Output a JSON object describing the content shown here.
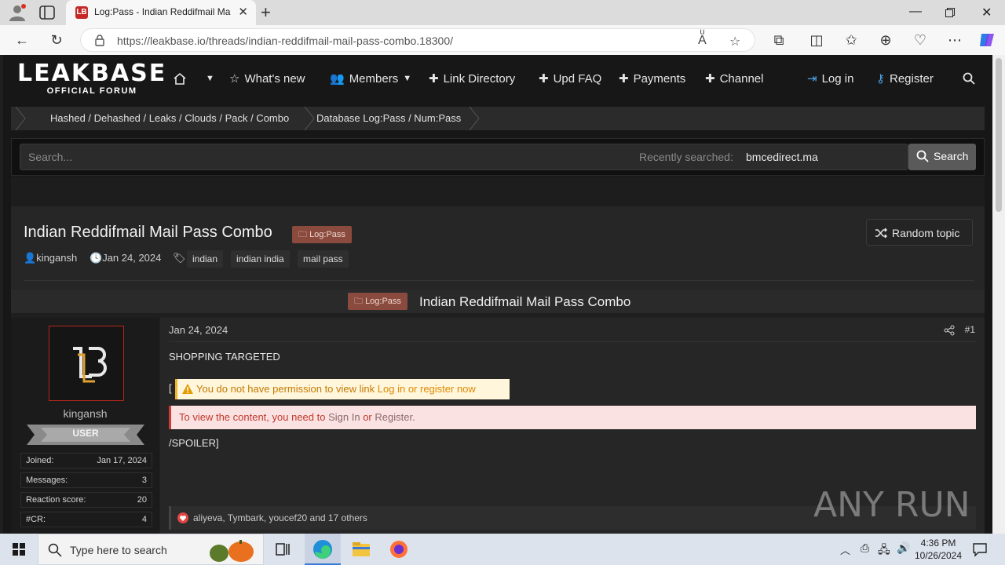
{
  "browser": {
    "tab_title": "Log:Pass - Indian Reddifmail Ma",
    "url": "https://leakbase.io/threads/indian-reddifmail-mail-pass-combo.18300/"
  },
  "site": {
    "logo_main": "LEAKBASE",
    "logo_sub": "OFFICIAL FORUM",
    "nav": {
      "whats_new": "What's new",
      "members": "Members",
      "link_directory": "Link Directory",
      "upd_faq": "Upd FAQ",
      "payments": "Payments",
      "channel": "Channel",
      "login": "Log in",
      "register": "Register"
    },
    "breadcrumbs": {
      "first": "Hashed / Dehashed / Leaks / Clouds / Pack / Combo",
      "second": "Database Log:Pass / Num:Pass"
    },
    "search": {
      "placeholder": "Search...",
      "recent_label": "Recently searched:",
      "recent_value": "bmcedirect.ma",
      "button": "Search"
    }
  },
  "thread": {
    "title": "Indian Reddifmail Mail Pass Combo",
    "prefix": "Log:Pass",
    "random_topic": "Random topic",
    "author": "kingansh",
    "date": "Jan 24, 2024",
    "tags": [
      "indian",
      "indian india",
      "mail pass"
    ]
  },
  "post": {
    "header_prefix": "Log:Pass",
    "header_title": "Indian Reddifmail Mail Pass Combo",
    "date": "Jan 24, 2024",
    "number": "#1",
    "line1": "SHOPPING TARGETED",
    "bracket": "[",
    "warning": "You do not have permission to view link",
    "warning_link": "Log in or register now",
    "deny_text": "To view the content, you need to",
    "deny_signin": "Sign In",
    "deny_or": "or",
    "deny_register": "Register.",
    "spoiler_end": "/SPOILER]",
    "reactions": "aliyeva, Tymbark, youcef20 and 17 others"
  },
  "user": {
    "name": "kingansh",
    "rank": "USER",
    "stats": [
      {
        "k": "Joined:",
        "v": "Jan 17, 2024"
      },
      {
        "k": "Messages:",
        "v": "3"
      },
      {
        "k": "Reaction score:",
        "v": "20"
      },
      {
        "k": "#CR:",
        "v": "4"
      }
    ]
  },
  "watermark": "ANY RUN",
  "taskbar": {
    "search_placeholder": "Type here to search",
    "time": "4:36 PM",
    "date": "10/26/2024"
  },
  "colors": {
    "accent_blue": "#4aa3e8",
    "prefix_badge": "#8a4b3e",
    "warning_bg": "#fff6dc",
    "deny_bg": "#fbe2e2"
  }
}
